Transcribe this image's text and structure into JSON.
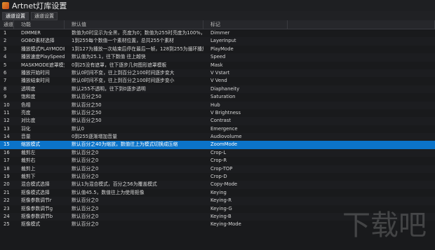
{
  "window": {
    "title": "Artnet灯库设置"
  },
  "tabs": [
    {
      "label": "通道设置"
    },
    {
      "label": "通道设置"
    }
  ],
  "table": {
    "headers": [
      "通道",
      "功能",
      "默认值",
      "标记"
    ],
    "rows": [
      {
        "idx": "1",
        "func": "DIMMER",
        "def": "数值为0时显示为全黑，亮度为0；数值为255时亮度为100%，通道...",
        "label": "Dimmer"
      },
      {
        "idx": "2",
        "func": "GOBO素材选择",
        "def": "1到255每个数值一个素材位置，总共255个素材",
        "label": "LayerInput"
      },
      {
        "idx": "3",
        "func": "播放模式PLAYMODE",
        "def": "1到127为播放一次结束后停在最后一帧，128到255为循环播放",
        "label": "PlayMode"
      },
      {
        "idx": "4",
        "func": "播放速度PlaySpeed",
        "def": "默认值为25.1，往下数值 往上越快",
        "label": "Speed"
      },
      {
        "idx": "5",
        "func": "MASKMODE遮罩模式",
        "def": "0到25没有遮罩，往下逐步几何图形遮罩模板",
        "label": "Mask"
      },
      {
        "idx": "6",
        "func": "播放开始时间",
        "def": "默认0时间不变，往上到百分之100时间逐步变大",
        "label": "V Vstart"
      },
      {
        "idx": "7",
        "func": "播放结束时间",
        "def": "默认0时间不变，往上到百分之100时间逐步变小",
        "label": "V Vend"
      },
      {
        "idx": "8",
        "func": "透明度",
        "def": "默认255不透明，往下到0逐步透明",
        "label": "Diaphaneity"
      },
      {
        "idx": "9",
        "func": "饱和度",
        "def": "默认百分之50",
        "label": "Saturation"
      },
      {
        "idx": "10",
        "func": "色相",
        "def": "默认百分之50",
        "label": "Hub"
      },
      {
        "idx": "11",
        "func": "亮度",
        "def": "默认百分之50",
        "label": "V Brightness"
      },
      {
        "idx": "12",
        "func": "对比度",
        "def": "默认百分之50",
        "label": "Contrast"
      },
      {
        "idx": "13",
        "func": "羽化",
        "def": "默认0",
        "label": "Emergence"
      },
      {
        "idx": "14",
        "func": "音量",
        "def": "0到255逐渐增加音量",
        "label": "Audiovolume"
      },
      {
        "idx": "15",
        "func": "缩放模式",
        "def": "默认百分之40为缩放，数值往上为模式切换成压缩",
        "label": "ZoomMode"
      },
      {
        "idx": "16",
        "func": "裁剪左",
        "def": "默认百分之0",
        "label": "Crop-L"
      },
      {
        "idx": "17",
        "func": "裁剪右",
        "def": "默认百分之0",
        "label": "Crop-R"
      },
      {
        "idx": "18",
        "func": "裁剪上",
        "def": "默认百分之0",
        "label": "Crop-TOP"
      },
      {
        "idx": "19",
        "func": "裁剪下",
        "def": "默认百分之0",
        "label": "Crop-D"
      },
      {
        "idx": "20",
        "func": "混合模式选择",
        "def": "默认1为混合模式，百分之56为覆盖模式",
        "label": "Copy-Mode"
      },
      {
        "idx": "21",
        "func": "抠像模式选择",
        "def": "默认值45.5，数值往上为使用抠像",
        "label": "Keying"
      },
      {
        "idx": "22",
        "func": "抠像参数调节r",
        "def": "默认百分之0",
        "label": "Keying-R"
      },
      {
        "idx": "23",
        "func": "抠像参数调节g",
        "def": "默认百分之0",
        "label": "Keying-G"
      },
      {
        "idx": "24",
        "func": "抠像参数调节b",
        "def": "默认百分之0",
        "label": "Keying-B"
      },
      {
        "idx": "25",
        "func": "抠像模式",
        "def": "默认百分之0",
        "label": "Keying-Mode"
      }
    ],
    "selected_index": 14
  },
  "watermark": {
    "text": "下载吧"
  },
  "colors": {
    "selected_row": "#0b73c9",
    "background": "#191a1c"
  }
}
